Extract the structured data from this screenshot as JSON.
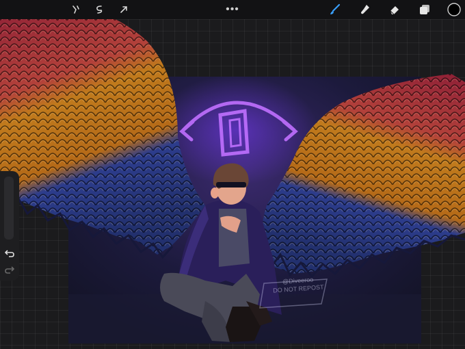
{
  "toolbar": {
    "left_tools": [
      "adjustments-icon",
      "selection-icon",
      "transform-icon"
    ],
    "more_label": "•••",
    "right_tools": [
      "brush-icon",
      "smudge-icon",
      "eraser-icon",
      "layers-icon",
      "color-swatch"
    ],
    "active_tool": "brush-icon",
    "accent_color": "#3aa0ff",
    "current_color": "#000000"
  },
  "sidebar": {
    "buttons": [
      "undo-icon",
      "redo-icon"
    ]
  },
  "artwork": {
    "watermark_line1": "@Diveeroo",
    "watermark_line2": "DO NOT REPOST",
    "wing_colors": [
      "#a82842",
      "#c07a1c",
      "#2c3c8c"
    ],
    "neon_color": "#b060ff"
  }
}
